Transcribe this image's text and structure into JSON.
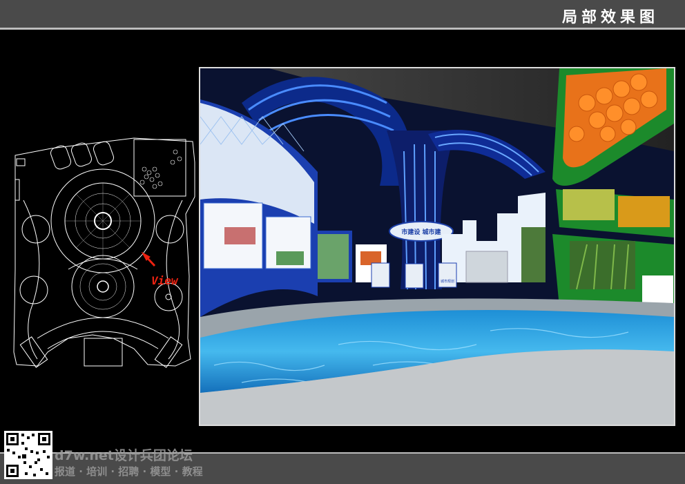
{
  "header": {
    "title": "局部效果图"
  },
  "floorplan": {
    "view_label": "View"
  },
  "render": {
    "banner_text": "市建设  城市建",
    "kiosk_label": "城市规划"
  },
  "watermark": {
    "site": "d7w.net设计兵团论坛",
    "tagline": "报道 · 培训 · 招聘 · 模型 · 教程"
  }
}
